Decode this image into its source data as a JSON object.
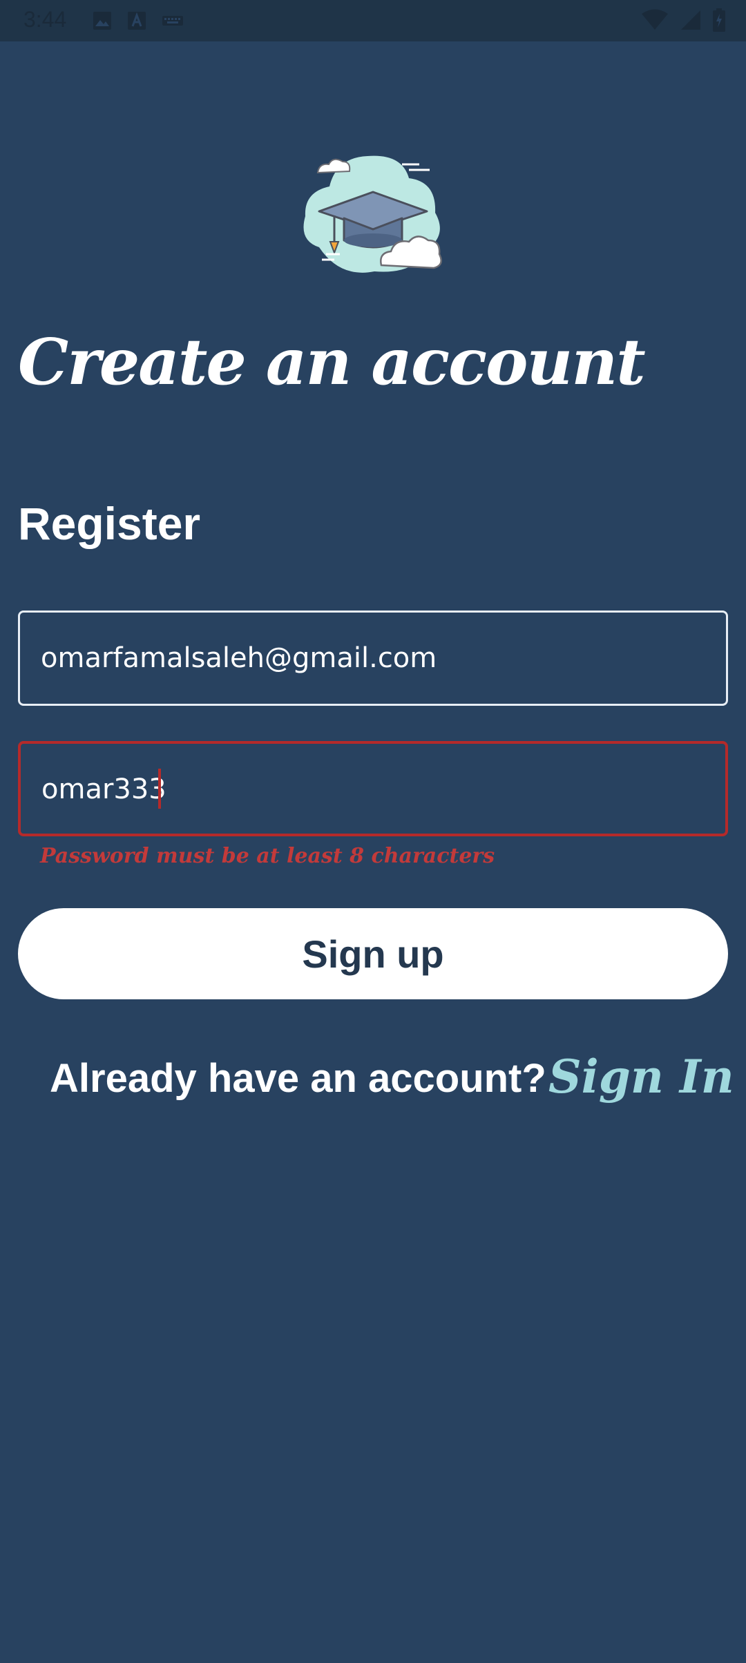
{
  "status_bar": {
    "time": "3:44",
    "left_icons": [
      "image-icon",
      "text-a-icon",
      "keyboard-icon"
    ],
    "right_icons": [
      "wifi-icon",
      "signal-icon",
      "battery-icon"
    ]
  },
  "logo": {
    "icon": "graduation-cap-cloud-icon"
  },
  "title": "Create an account",
  "subtitle": "Register",
  "form": {
    "email_value": "omarfamalsaleh@gmail.com",
    "password_value": "omar333",
    "password_error": "Password must be at least 8 characters"
  },
  "actions": {
    "signup_label": "Sign up",
    "already_label": "Already have an account?",
    "signin_label": "Sign In"
  },
  "colors": {
    "background": "#284260",
    "error": "#b52a2a",
    "link": "#9fd8dd",
    "button_text": "#24384f"
  }
}
